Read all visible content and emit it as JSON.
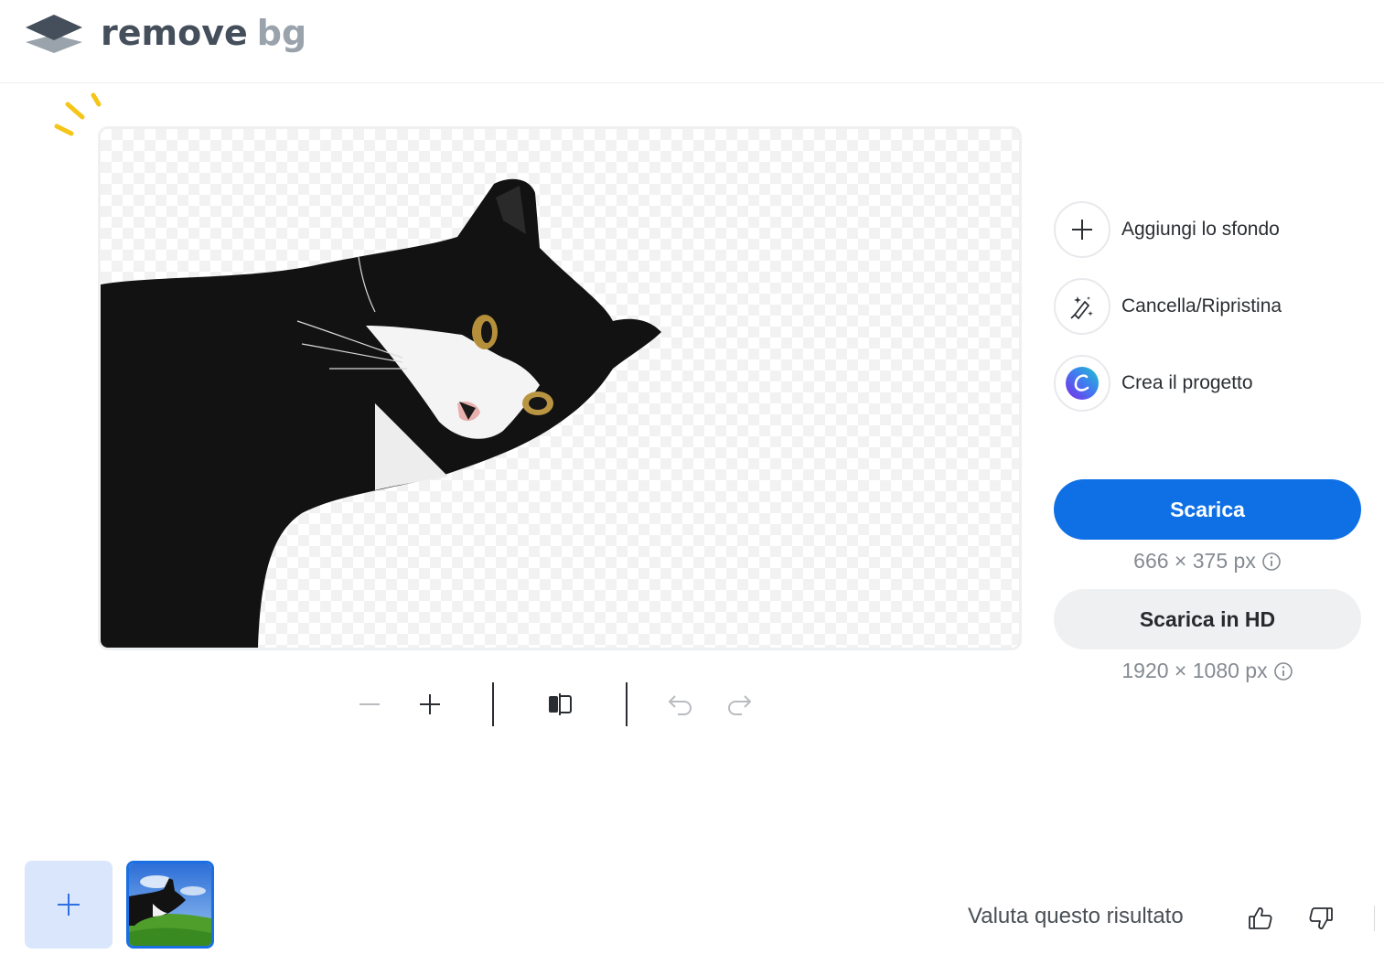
{
  "header": {
    "logo_word1": "remove",
    "logo_word2": "bg"
  },
  "toolbar": {
    "zoom_out": "zoom-out",
    "zoom_in": "zoom-in",
    "compare": "compare",
    "undo": "undo",
    "redo": "redo"
  },
  "actions": [
    {
      "label": "Aggiungi lo sfondo",
      "icon": "plus-icon"
    },
    {
      "label": "Cancella/Ripristina",
      "icon": "magic-brush-icon"
    },
    {
      "label": "Crea il progetto",
      "icon": "canva-logo-icon"
    }
  ],
  "download": {
    "label": "Scarica",
    "dimensions": "666 × 375 px"
  },
  "download_hd": {
    "label": "Scarica in HD",
    "dimensions": "1920 × 1080 px"
  },
  "feedback": {
    "label": "Valuta questo risultato"
  },
  "colors": {
    "primary": "#0f70e6",
    "secondary_bg": "#eff0f2",
    "add_tile_bg": "#d9e6fc",
    "sparkle": "#f5c518"
  }
}
